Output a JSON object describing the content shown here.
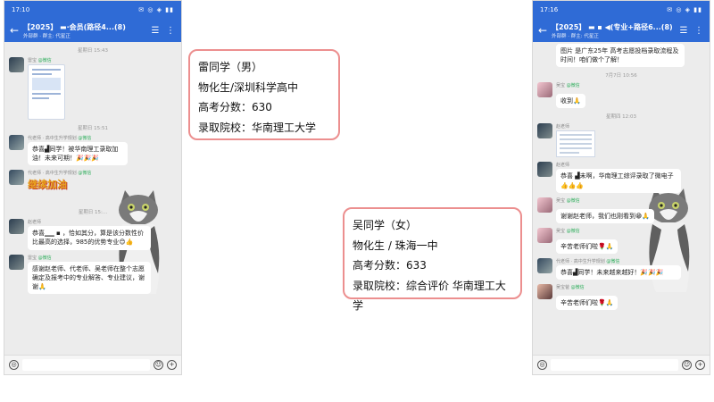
{
  "left_phone": {
    "status_time": "17:10",
    "status_icons": "✉ ◎ ◈ ▮▮",
    "chat_title": "【2025】 ▬·会员(路径4...(8)",
    "chat_subtitle": "外部群 · 群主: 代星正",
    "messages": [
      {
        "type": "time",
        "text": "星期日 15:43"
      },
      {
        "type": "image",
        "avatar": "a1",
        "sender": "雷宝",
        "tag": "@微信"
      },
      {
        "type": "time",
        "text": "星期日 15:51"
      },
      {
        "type": "text",
        "avatar": "a2",
        "sender": "代老师 · 高中生升学规划",
        "tag": "@微信",
        "text": "恭喜▟同学！被华南理工录取加油！未来可期！🎉🎉🎉"
      },
      {
        "type": "sticker",
        "avatar": "a2",
        "sender": "代老师 · 高中生升学规划",
        "tag": "@微信",
        "text": "继续加油"
      },
      {
        "type": "time",
        "text": "星期日 15:..."
      },
      {
        "type": "text",
        "avatar": "a1",
        "sender": "赵老师",
        "tag": "",
        "text": "恭喜▁▁ ▪ ，恰如其分，算是该分数性价比最高的选择，985的优势专业😊👍"
      },
      {
        "type": "text",
        "avatar": "a1",
        "sender": "雷宝",
        "tag": "@微信",
        "text": "感谢赵老师、代老师、吴老师在整个志愿确定及报考中的专业解答、专业建议，谢谢🙏"
      }
    ]
  },
  "right_phone": {
    "status_time": "17:16",
    "status_icons": "✉ ◎ ◈ ▮▮",
    "chat_title": "【2025】 ▬ ▪ ◀(专业+路径6...(8)",
    "chat_subtitle": "外部群 · 群主: 代星正",
    "messages": [
      {
        "type": "text",
        "avatar": "",
        "sender": "",
        "tag": "",
        "text": "图片 是广东25年 高考志愿投档录取流程及时间！咱们做个了解！"
      },
      {
        "type": "time",
        "text": "7月7日 10:56"
      },
      {
        "type": "text",
        "avatar": "a3",
        "sender": "吴宝",
        "tag": "@微信",
        "text": "收到🙏"
      },
      {
        "type": "time",
        "text": "星期四 12:03"
      },
      {
        "type": "table",
        "avatar": "a1",
        "sender": "赵老师",
        "tag": ""
      },
      {
        "type": "text",
        "avatar": "a1",
        "sender": "赵老师",
        "tag": "",
        "text": "恭喜 ▟未啊，华南理工综评录取了微电子👍👍👍"
      },
      {
        "type": "text",
        "avatar": "a3",
        "sender": "吴宝",
        "tag": "@微信",
        "text": "谢谢赵老师，我们也刚看到😁🙏"
      },
      {
        "type": "text",
        "avatar": "a3",
        "sender": "吴宝",
        "tag": "@微信",
        "text": "辛苦老师们啦🌹🙏"
      },
      {
        "type": "text",
        "avatar": "a2",
        "sender": "代老师 · 高中生升学规划",
        "tag": "@微信",
        "text": "恭喜▟同学！未来越来越好！🎉🎉🎉"
      },
      {
        "type": "text",
        "avatar": "a4",
        "sender": "吴宝爸",
        "tag": "@微信",
        "text": "辛苦老师们啦🌹🙏"
      }
    ]
  },
  "card1": {
    "name": "雷同学（男）",
    "subjects": "物化生/深圳科学高中",
    "score": "高考分数：630",
    "admission": "录取院校：华南理工大学"
  },
  "card2": {
    "name": "吴同学（女）",
    "subjects": "物化生 / 珠海一中",
    "score": "高考分数：633",
    "admission": "录取院校：综合评价 华南理工大学"
  },
  "icons": {
    "back": "back-arrow-icon",
    "menu": "menu-icon",
    "more": "more-icon",
    "voice": "voice-icon",
    "emoji": "emoji-icon",
    "plus": "plus-icon"
  }
}
